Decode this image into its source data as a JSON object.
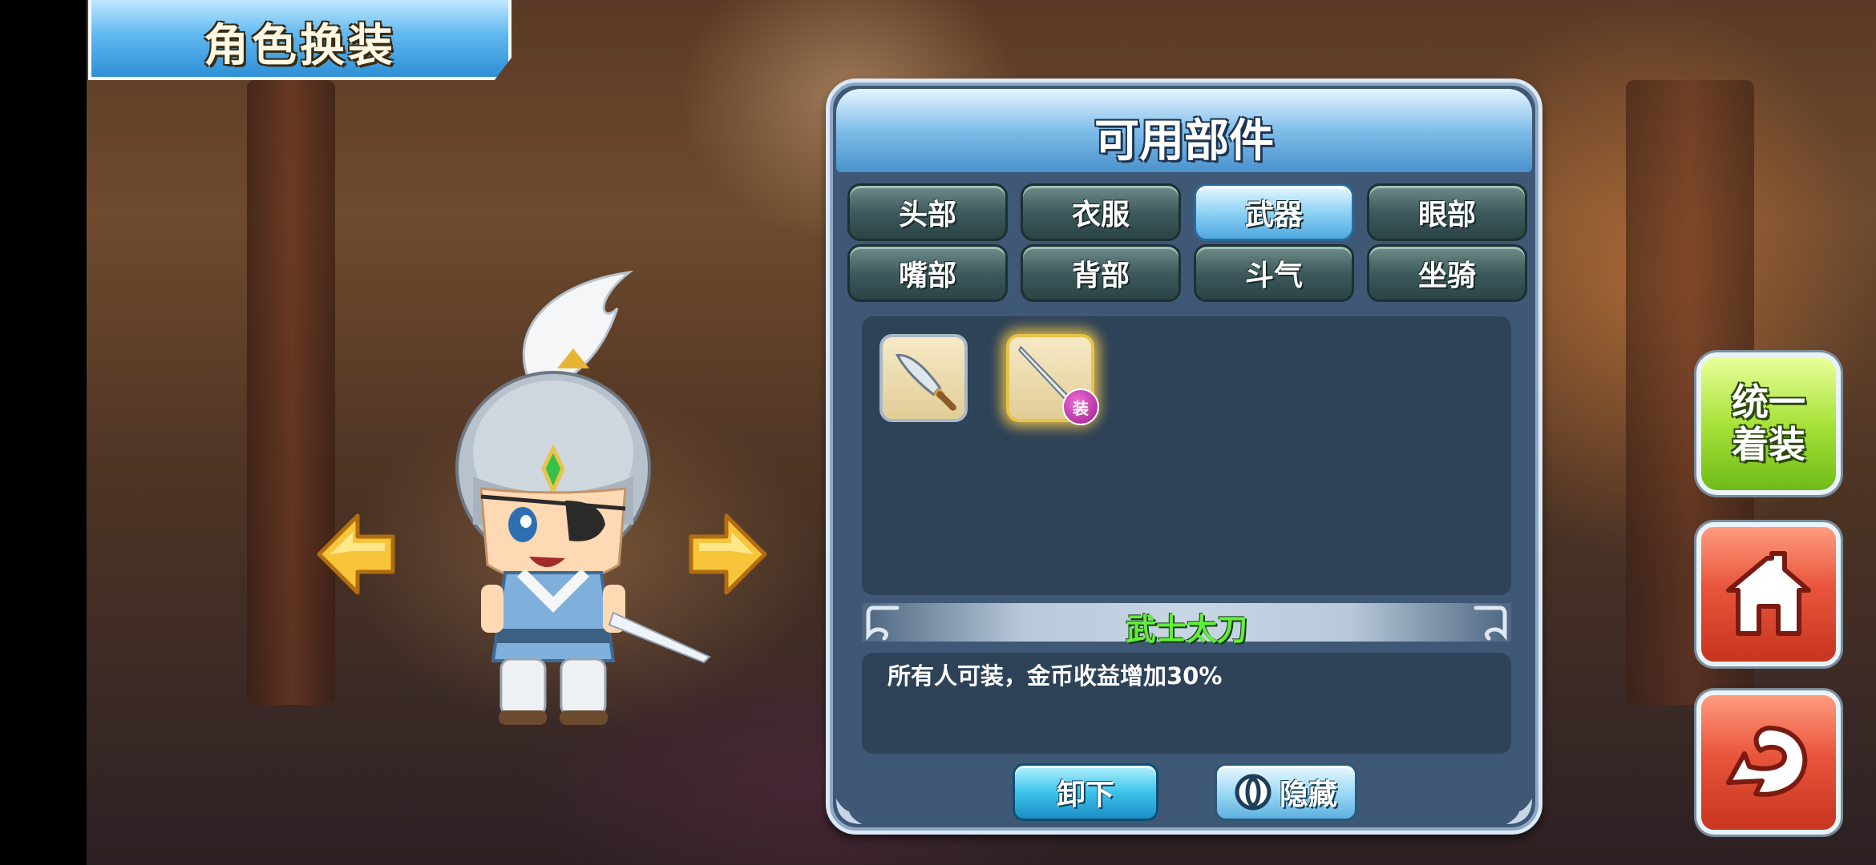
{
  "header": {
    "title": "角色换装"
  },
  "panel": {
    "title": "可用部件",
    "tabs": [
      {
        "label": "头部"
      },
      {
        "label": "衣服"
      },
      {
        "label": "武器"
      },
      {
        "label": "眼部"
      },
      {
        "label": "嘴部"
      },
      {
        "label": "背部"
      },
      {
        "label": "斗气"
      },
      {
        "label": "坐骑"
      }
    ],
    "active_tab": "武器",
    "items": [
      {
        "icon": "broadsword-icon",
        "selected": false,
        "equipped": false
      },
      {
        "icon": "katana-icon",
        "selected": true,
        "equipped": true,
        "badge": "装"
      }
    ],
    "selected_item": {
      "name": "武士太刀",
      "description": "所有人可装，金币收益增加30%"
    },
    "buttons": {
      "unequip": "卸下",
      "hide": "隐藏"
    }
  },
  "side_buttons": {
    "unify_outfit": "统一着装",
    "home_icon": "home-icon",
    "back_icon": "back-icon"
  },
  "colors": {
    "item_name": "#5ff03a",
    "panel_bg": "#3f5876",
    "active_tab": "#8fd2f5",
    "unify_button": "#a8e23a",
    "red_button": "#e8553c"
  }
}
